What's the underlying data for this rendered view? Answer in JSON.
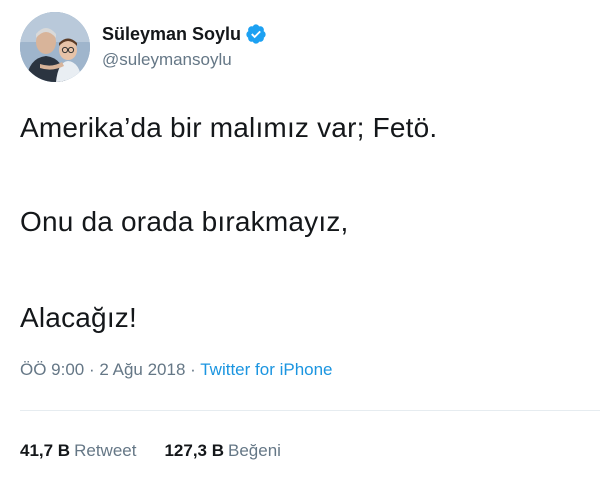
{
  "user": {
    "display_name": "Süleyman Soylu",
    "handle": "@suleymansoylu",
    "verified": true,
    "verified_icon": "verified-badge-icon",
    "verified_color": "#1da1f2"
  },
  "tweet": {
    "lines": [
      "Amerika’da bir malımız var; Fetö.",
      "Onu da orada bırakmayız,",
      "Alacağız!"
    ]
  },
  "meta": {
    "time": "ÖÖ 9:00",
    "separator": "·",
    "date": "2 Ağu 2018",
    "source": "Twitter for iPhone",
    "source_color": "#1b95e0"
  },
  "stats": {
    "retweets": {
      "count": "41,7 B",
      "label": "Retweet"
    },
    "likes": {
      "count": "127,3 B",
      "label": "Beğeni"
    }
  }
}
